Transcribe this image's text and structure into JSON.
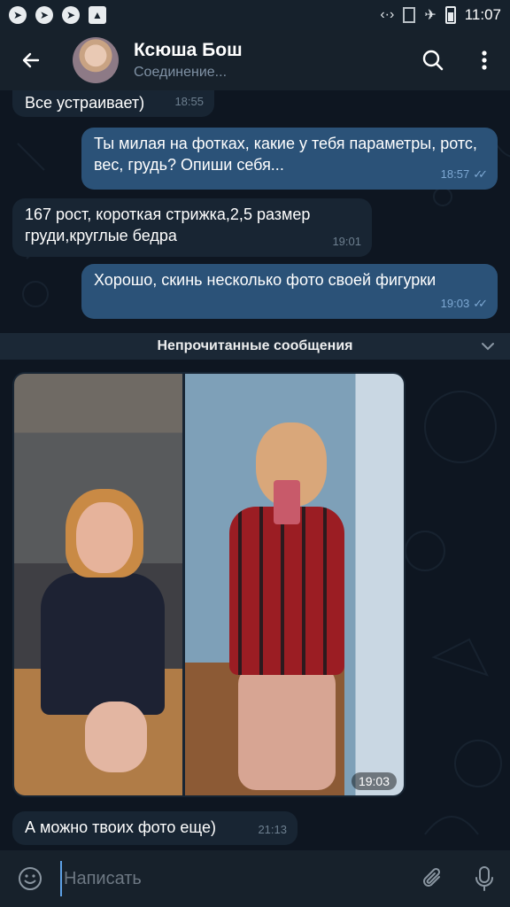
{
  "status_bar": {
    "time": "11:07"
  },
  "header": {
    "title": "Ксюша Бош",
    "subtitle": "Соединение..."
  },
  "messages": [
    {
      "text": "Все устраивает)",
      "time": "18:55"
    },
    {
      "text": "Ты милая на фотках, какие у тебя параметры, ротс, вес, грудь? Опиши себя...",
      "time": "18:57"
    },
    {
      "text": "167 рост, короткая стрижка,2,5 размер груди,круглые бедра",
      "time": "19:01"
    },
    {
      "text": "Хорошо, скинь несколько фото своей фигурки",
      "time": "19:03"
    }
  ],
  "unread_label": "Непрочитанные сообщения",
  "photo_album": {
    "time": "19:03"
  },
  "last_message": {
    "text": "А можно твоих фото еще)",
    "time": "21:13"
  },
  "composer": {
    "placeholder": "Написать"
  },
  "colors": {
    "background": "#0e1621",
    "header": "#17212b",
    "incoming_bubble": "#182533",
    "outgoing_bubble": "#2b5278",
    "accent": "#5ea1e6"
  }
}
